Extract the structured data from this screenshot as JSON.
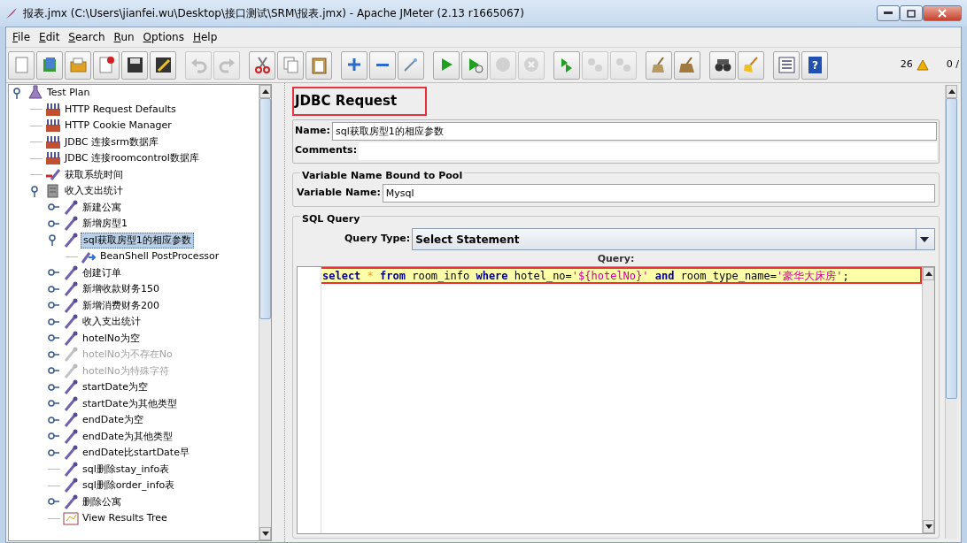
{
  "window": {
    "title": "报表.jmx (C:\\Users\\jianfei.wu\\Desktop\\接口测试\\SRM\\报表.jmx) - Apache JMeter (2.13 r1665067)"
  },
  "menu": [
    "File",
    "Edit",
    "Search",
    "Run",
    "Options",
    "Help"
  ],
  "toolbar": [
    [
      {
        "kind": "new",
        "disabled": false
      },
      {
        "kind": "templates",
        "disabled": false
      },
      {
        "kind": "open",
        "disabled": false
      },
      {
        "kind": "close",
        "disabled": false
      },
      {
        "kind": "save",
        "disabled": false
      },
      {
        "kind": "screenshot",
        "disabled": false
      }
    ],
    [
      {
        "kind": "undo",
        "disabled": true
      },
      {
        "kind": "redo",
        "disabled": true
      }
    ],
    [
      {
        "kind": "cut",
        "disabled": false
      },
      {
        "kind": "copy",
        "disabled": false
      },
      {
        "kind": "paste",
        "disabled": false
      }
    ],
    [
      {
        "kind": "expand",
        "disabled": false
      },
      {
        "kind": "collapse",
        "disabled": false
      },
      {
        "kind": "toggle",
        "disabled": false
      }
    ],
    [
      {
        "kind": "start",
        "disabled": false
      },
      {
        "kind": "start-no-pause",
        "disabled": false
      },
      {
        "kind": "stop",
        "disabled": true
      },
      {
        "kind": "shutdown",
        "disabled": true
      }
    ],
    [
      {
        "kind": "remote-start",
        "disabled": false
      },
      {
        "kind": "remote-stop",
        "disabled": true
      },
      {
        "kind": "remote-shutdown",
        "disabled": true
      }
    ],
    [
      {
        "kind": "clear",
        "disabled": false
      },
      {
        "kind": "clear-all",
        "disabled": false
      }
    ],
    [
      {
        "kind": "search",
        "disabled": false
      },
      {
        "kind": "reset-search",
        "disabled": false
      }
    ],
    [
      {
        "kind": "function-helper",
        "disabled": false
      },
      {
        "kind": "help",
        "disabled": false,
        "glyph": "?"
      }
    ]
  ],
  "status": {
    "warnings": "26",
    "threads": "0 /"
  },
  "tree": [
    {
      "label": "Test Plan",
      "kind": "testplan",
      "expanded": true,
      "selected": false,
      "disabled": false,
      "children": [
        {
          "label": "HTTP Request Defaults",
          "kind": "config",
          "selected": false,
          "disabled": false
        },
        {
          "label": "HTTP Cookie Manager",
          "kind": "config",
          "selected": false,
          "disabled": false
        },
        {
          "label": "JDBC 连接srm数据库",
          "kind": "config",
          "selected": false,
          "disabled": false
        },
        {
          "label": "JDBC 连接roomcontrol数据库",
          "kind": "config",
          "selected": false,
          "disabled": false
        },
        {
          "label": "获取系统时间",
          "kind": "preprocessor",
          "selected": false,
          "disabled": false
        },
        {
          "label": "收入支出统计",
          "kind": "threadgroup",
          "expanded": true,
          "selected": false,
          "disabled": false,
          "children": [
            {
              "label": "新建公寓",
              "kind": "sampler",
              "expanded": false,
              "selected": false,
              "disabled": false
            },
            {
              "label": "新增房型1",
              "kind": "sampler",
              "expanded": false,
              "selected": false,
              "disabled": false
            },
            {
              "label": "sql获取房型1的相应参数",
              "kind": "sampler",
              "expanded": true,
              "selected": true,
              "disabled": false,
              "children": [
                {
                  "label": "BeanShell PostProcessor",
                  "kind": "postprocessor",
                  "selected": false,
                  "disabled": false
                }
              ]
            },
            {
              "label": "创建订单",
              "kind": "sampler",
              "expanded": false,
              "selected": false,
              "disabled": false
            },
            {
              "label": "新增收款财务150",
              "kind": "sampler",
              "expanded": false,
              "selected": false,
              "disabled": false
            },
            {
              "label": "新增消费财务200",
              "kind": "sampler",
              "expanded": false,
              "selected": false,
              "disabled": false
            },
            {
              "label": "收入支出统计",
              "kind": "sampler",
              "expanded": false,
              "selected": false,
              "disabled": false
            },
            {
              "label": "hotelNo为空",
              "kind": "sampler",
              "expanded": false,
              "selected": false,
              "disabled": false
            },
            {
              "label": "hotelNo为不存在No",
              "kind": "sampler",
              "expanded": false,
              "selected": false,
              "disabled": true
            },
            {
              "label": "hotelNo为特殊字符",
              "kind": "sampler",
              "expanded": false,
              "selected": false,
              "disabled": true
            },
            {
              "label": "startDate为空",
              "kind": "sampler",
              "expanded": false,
              "selected": false,
              "disabled": false
            },
            {
              "label": "startDate为其他类型",
              "kind": "sampler",
              "expanded": false,
              "selected": false,
              "disabled": false
            },
            {
              "label": "endDate为空",
              "kind": "sampler",
              "expanded": false,
              "selected": false,
              "disabled": false
            },
            {
              "label": "endDate为其他类型",
              "kind": "sampler",
              "expanded": false,
              "selected": false,
              "disabled": false
            },
            {
              "label": "endDate比startDate早",
              "kind": "sampler",
              "expanded": false,
              "selected": false,
              "disabled": false
            },
            {
              "label": "sql删除stay_info表",
              "kind": "sampler",
              "selected": false,
              "disabled": false
            },
            {
              "label": "sql删除order_info表",
              "kind": "sampler",
              "selected": false,
              "disabled": false
            },
            {
              "label": "删除公寓",
              "kind": "sampler",
              "expanded": false,
              "selected": false,
              "disabled": false
            },
            {
              "label": "View Results Tree",
              "kind": "listener",
              "selected": false,
              "disabled": false
            }
          ]
        }
      ]
    }
  ],
  "editor": {
    "title": "JDBC Request",
    "title_highlighted": true,
    "name_label": "Name:",
    "name": "sql获取房型1的相应参数",
    "comments_label": "Comments:",
    "pool_group": "Variable Name Bound to Pool",
    "variable_label": "Variable Name:",
    "variable": "Mysql",
    "sql_group": "SQL Query",
    "query_type_label": "Query Type:",
    "query_type": "Select Statement",
    "query_label": "Query:",
    "query_highlighted": true,
    "query_tokens": [
      {
        "text": "select",
        "kind": "keyword"
      },
      {
        "text": " * ",
        "kind": "operator"
      },
      {
        "text": "from",
        "kind": "keyword"
      },
      {
        "text": " room_info ",
        "kind": "plain"
      },
      {
        "text": "where",
        "kind": "keyword"
      },
      {
        "text": " hotel_no=",
        "kind": "plain"
      },
      {
        "text": "'${hotelNo}'",
        "kind": "string"
      },
      {
        "text": " and",
        "kind": "keyword"
      },
      {
        "text": " room_type_name=",
        "kind": "plain"
      },
      {
        "text": "'豪华大床房'",
        "kind": "string"
      },
      {
        "text": ";",
        "kind": "plain"
      }
    ]
  }
}
